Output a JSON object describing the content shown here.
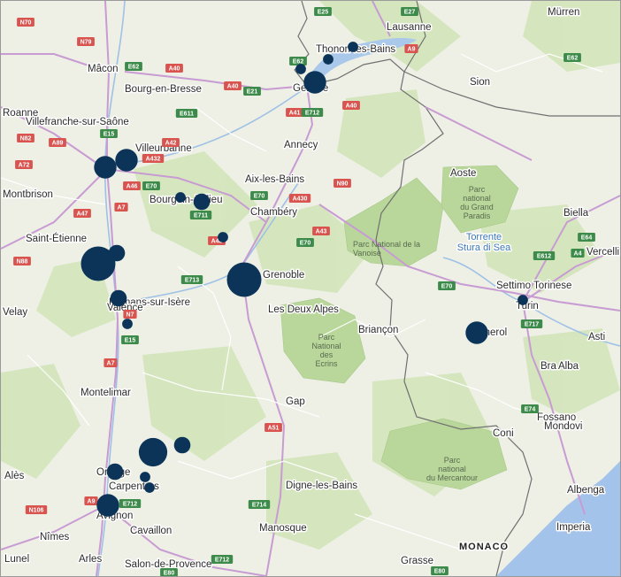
{
  "map": {
    "colors": {
      "land": "#eef0e6",
      "forest": "#cfe3b4",
      "park": "#b7d696",
      "water": "#aac8ea",
      "sea": "#a4c3ea",
      "road_major": "#c89bd3",
      "road_minor": "#ffffff",
      "border": "#6e6e6e",
      "bubble": "#0b3458",
      "shield_red": "#d9534f",
      "shield_green": "#3d8b4a"
    },
    "places": [
      {
        "name": "Lausanne",
        "kind": "city"
      },
      {
        "name": "Mürren",
        "kind": "city"
      },
      {
        "name": "Thonon-les-Bains",
        "kind": "city"
      },
      {
        "name": "Mâcon",
        "kind": "city"
      },
      {
        "name": "Sion",
        "kind": "city"
      },
      {
        "name": "Bourg-en-Bresse",
        "kind": "city"
      },
      {
        "name": "Genève",
        "kind": "city"
      },
      {
        "name": "Villefranche-sur-Saône",
        "kind": "city"
      },
      {
        "name": "Annecy",
        "kind": "city"
      },
      {
        "name": "Villeurbanne",
        "kind": "city"
      },
      {
        "name": "Aix-les-Bains",
        "kind": "city"
      },
      {
        "name": "Aoste",
        "kind": "city"
      },
      {
        "name": "Bourgoin-Jallieu",
        "kind": "city"
      },
      {
        "name": "Chambéry",
        "kind": "city"
      },
      {
        "name": "Biella",
        "kind": "city"
      },
      {
        "name": "Saint-Étienne",
        "kind": "city"
      },
      {
        "name": "Vercelli",
        "kind": "city"
      },
      {
        "name": "Grenoble",
        "kind": "city"
      },
      {
        "name": "Settimo Torinese",
        "kind": "city"
      },
      {
        "name": "Romans-sur-Isère",
        "kind": "city"
      },
      {
        "name": "Les Deux Alpes",
        "kind": "city"
      },
      {
        "name": "Turin",
        "kind": "city"
      },
      {
        "name": "Valence",
        "kind": "city"
      },
      {
        "name": "Briançon",
        "kind": "city"
      },
      {
        "name": "Pignerol",
        "kind": "city"
      },
      {
        "name": "Asti",
        "kind": "city"
      },
      {
        "name": "Bra",
        "kind": "city"
      },
      {
        "name": "Alba",
        "kind": "city"
      },
      {
        "name": "Montelimar",
        "kind": "city"
      },
      {
        "name": "Fossano",
        "kind": "city"
      },
      {
        "name": "Gap",
        "kind": "city"
      },
      {
        "name": "Mondovi",
        "kind": "city"
      },
      {
        "name": "Coni",
        "kind": "city"
      },
      {
        "name": "Orange",
        "kind": "city"
      },
      {
        "name": "Carpentras",
        "kind": "city"
      },
      {
        "name": "Digne-les-Bains",
        "kind": "city"
      },
      {
        "name": "Albenga",
        "kind": "city"
      },
      {
        "name": "Avignon",
        "kind": "city"
      },
      {
        "name": "Imperia",
        "kind": "city"
      },
      {
        "name": "Cavaillon",
        "kind": "city"
      },
      {
        "name": "Manosque",
        "kind": "city"
      },
      {
        "name": "Nîmes",
        "kind": "city"
      },
      {
        "name": "Arles",
        "kind": "city"
      },
      {
        "name": "Salon-de-Provence",
        "kind": "city"
      },
      {
        "name": "Grasse",
        "kind": "city"
      },
      {
        "name": "Alès",
        "kind": "city"
      },
      {
        "name": "Velay",
        "kind": "city"
      },
      {
        "name": "Lunel",
        "kind": "city"
      },
      {
        "name": "Roanne",
        "kind": "city"
      },
      {
        "name": "Montbrison",
        "kind": "city"
      }
    ],
    "parks": [
      {
        "lines": [
          "Parc National de la",
          "Vanoise"
        ]
      },
      {
        "lines": [
          "Parc",
          "national",
          "du Grand",
          "Paradis"
        ]
      },
      {
        "lines": [
          "Parc",
          "National",
          "des",
          "Ecrins"
        ]
      },
      {
        "lines": [
          "Parc",
          "national",
          "du Mercantour"
        ]
      }
    ],
    "water_label": [
      "Torrente",
      "Stura di Sea"
    ],
    "country_label": "MONACO",
    "highway_shields": [
      {
        "label": "N70",
        "color": "red"
      },
      {
        "label": "E25",
        "color": "green"
      },
      {
        "label": "E27",
        "color": "green"
      },
      {
        "label": "N79",
        "color": "red"
      },
      {
        "label": "E62",
        "color": "green"
      },
      {
        "label": "A9",
        "color": "red"
      },
      {
        "label": "E62",
        "color": "green"
      },
      {
        "label": "A40",
        "color": "red"
      },
      {
        "label": "E62",
        "color": "green"
      },
      {
        "label": "A40",
        "color": "red"
      },
      {
        "label": "E21",
        "color": "green"
      },
      {
        "label": "E611",
        "color": "green"
      },
      {
        "label": "A41",
        "color": "red"
      },
      {
        "label": "E712",
        "color": "green"
      },
      {
        "label": "A40",
        "color": "red"
      },
      {
        "label": "N82",
        "color": "red"
      },
      {
        "label": "A89",
        "color": "red"
      },
      {
        "label": "E15",
        "color": "green"
      },
      {
        "label": "A42",
        "color": "red"
      },
      {
        "label": "A432",
        "color": "red"
      },
      {
        "label": "A72",
        "color": "red"
      },
      {
        "label": "A46",
        "color": "red"
      },
      {
        "label": "E70",
        "color": "green"
      },
      {
        "label": "E70",
        "color": "green"
      },
      {
        "label": "A430",
        "color": "red"
      },
      {
        "label": "N90",
        "color": "red"
      },
      {
        "label": "A47",
        "color": "red"
      },
      {
        "label": "A7",
        "color": "red"
      },
      {
        "label": "E711",
        "color": "green"
      },
      {
        "label": "A43",
        "color": "red"
      },
      {
        "label": "E612",
        "color": "green"
      },
      {
        "label": "A4",
        "color": "green"
      },
      {
        "label": "E64",
        "color": "green"
      },
      {
        "label": "N88",
        "color": "red"
      },
      {
        "label": "A48",
        "color": "red"
      },
      {
        "label": "E713",
        "color": "green"
      },
      {
        "label": "E70",
        "color": "green"
      },
      {
        "label": "E70",
        "color": "green"
      },
      {
        "label": "N7",
        "color": "red"
      },
      {
        "label": "E15",
        "color": "green"
      },
      {
        "label": "E717",
        "color": "green"
      },
      {
        "label": "A7",
        "color": "red"
      },
      {
        "label": "E74",
        "color": "green"
      },
      {
        "label": "A51",
        "color": "red"
      },
      {
        "label": "A9",
        "color": "red"
      },
      {
        "label": "N106",
        "color": "red"
      },
      {
        "label": "E712",
        "color": "green"
      },
      {
        "label": "E714",
        "color": "green"
      },
      {
        "label": "E712",
        "color": "green"
      },
      {
        "label": "E80",
        "color": "green"
      },
      {
        "label": "E80",
        "color": "green"
      }
    ],
    "bubbles": [
      {
        "place": "Thonon-les-Bains",
        "size": 1
      },
      {
        "place": "Genève north",
        "size": 1
      },
      {
        "place": "Genève west",
        "size": 1
      },
      {
        "place": "Genève",
        "size": 3
      },
      {
        "place": "Lyon",
        "size": 3
      },
      {
        "place": "Villeurbanne",
        "size": 3
      },
      {
        "place": "Bourgoin-Jallieu west",
        "size": 1
      },
      {
        "place": "Bourgoin-Jallieu",
        "size": 2
      },
      {
        "place": "Voiron",
        "size": 1
      },
      {
        "place": "Saint-Étienne east",
        "size": 5
      },
      {
        "place": "Vienne",
        "size": 2
      },
      {
        "place": "Grenoble",
        "size": 5
      },
      {
        "place": "Romans-sur-Isère",
        "size": 2
      },
      {
        "place": "Valence",
        "size": 1
      },
      {
        "place": "Turin",
        "size": 1
      },
      {
        "place": "Pignerol",
        "size": 3
      },
      {
        "place": "Vaison",
        "size": 4
      },
      {
        "place": "Nyons",
        "size": 2
      },
      {
        "place": "Orange",
        "size": 2
      },
      {
        "place": "Carpentras north",
        "size": 1
      },
      {
        "place": "Carpentras",
        "size": 1
      },
      {
        "place": "Avignon",
        "size": 3
      }
    ]
  }
}
